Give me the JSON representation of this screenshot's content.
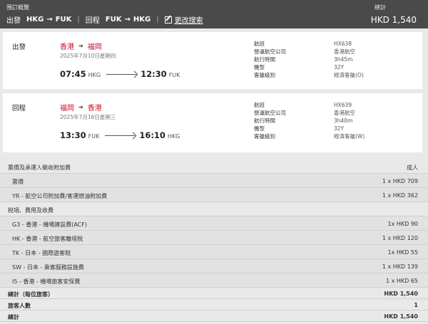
{
  "header": {
    "summary_title": "預訂概覽",
    "outbound_label": "出發",
    "outbound_from": "HKG",
    "outbound_to": "FUK",
    "return_label": "回程",
    "return_from": "FUK",
    "return_to": "HKG",
    "edit_search": "更改搜索",
    "total_label": "總計",
    "total_amount": "HKD 1,540"
  },
  "outbound": {
    "direction": "出發",
    "from_city": "香港",
    "to_city": "福岡",
    "date": "2025年7月10日星期四",
    "depart_time": "07:45",
    "depart_airport": "HKG",
    "arrive_time": "12:30",
    "arrive_airport": "FUK",
    "details": [
      {
        "label": "航班",
        "value": "HX638"
      },
      {
        "label": "營運航空公司",
        "value": "香港航空"
      },
      {
        "label": "航行時間",
        "value": "3h45m"
      },
      {
        "label": "機型",
        "value": "32Y"
      },
      {
        "label": "客艙級別",
        "value": "經濟客艙(O)"
      }
    ]
  },
  "inbound": {
    "direction": "回程",
    "from_city": "福岡",
    "to_city": "香港",
    "date": "2025年7月16日星期三",
    "depart_time": "13:30",
    "depart_airport": "FUK",
    "arrive_time": "16:10",
    "arrive_airport": "HKG",
    "details": [
      {
        "label": "航班",
        "value": "HX639"
      },
      {
        "label": "營運航空公司",
        "value": "香港航空"
      },
      {
        "label": "航行時間",
        "value": "3h40m"
      },
      {
        "label": "機型",
        "value": "32Y"
      },
      {
        "label": "客艙級別",
        "value": "經濟客艙(W)"
      }
    ]
  },
  "fare": {
    "header_label": "票價及承運人徵收附加費",
    "header_right": "成人",
    "base_fare_label": "票價",
    "base_fare_value": "1 x HKD 709",
    "yr_label": "YR - 航空公司附加費/客運燃油附加費",
    "yr_value": "1 x HKD 362",
    "taxes_label": "稅項、費用及收費",
    "taxes": [
      {
        "label": "G3 - 香港 - 機場建設費(ACF)",
        "value": "1x HKD 90"
      },
      {
        "label": "HK - 香港 - 航空旅客離境稅",
        "value": "1 x HKD 120"
      },
      {
        "label": "TK - 日本 - 國際遊客稅",
        "value": "1x HKD 55"
      },
      {
        "label": "SW - 日本 - 乘客服務設施費",
        "value": "1 x HKD 139"
      },
      {
        "label": "I5 - 香港 - 機場旅客安保費",
        "value": "1 x HKD 65"
      }
    ],
    "per_pax_label": "總計（每位旅客）",
    "per_pax_value": "HKD 1,540",
    "pax_count_label": "旅客人數",
    "pax_count_value": "1",
    "grand_total_label": "總計",
    "grand_total_value": "HKD 1,540"
  }
}
